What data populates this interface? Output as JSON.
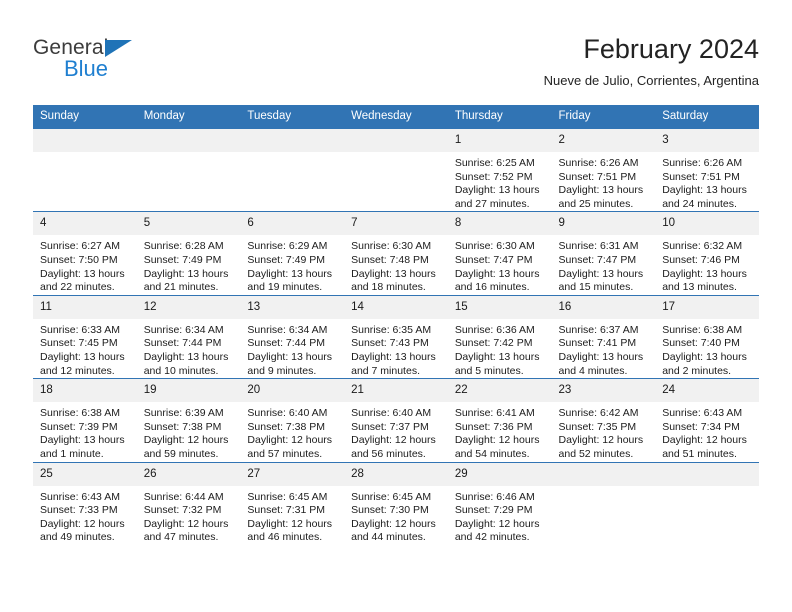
{
  "brand": {
    "name_part1": "General",
    "name_part2": "Blue",
    "accent_color": "#1f7fd0",
    "triangle_color": "#1f73b7"
  },
  "header": {
    "title": "February 2024",
    "subtitle": "Nueve de Julio, Corrientes, Argentina",
    "header_bg_color": "#3174b4",
    "daynum_bg_color": "#f1f1f1"
  },
  "weekday_headers": [
    "Sunday",
    "Monday",
    "Tuesday",
    "Wednesday",
    "Thursday",
    "Friday",
    "Saturday"
  ],
  "weeks": [
    [
      {
        "day": "",
        "sunrise": "",
        "sunset": "",
        "daylight1": "",
        "daylight2": "",
        "empty": true
      },
      {
        "day": "",
        "sunrise": "",
        "sunset": "",
        "daylight1": "",
        "daylight2": "",
        "empty": true
      },
      {
        "day": "",
        "sunrise": "",
        "sunset": "",
        "daylight1": "",
        "daylight2": "",
        "empty": true
      },
      {
        "day": "",
        "sunrise": "",
        "sunset": "",
        "daylight1": "",
        "daylight2": "",
        "empty": true
      },
      {
        "day": "1",
        "sunrise": "Sunrise: 6:25 AM",
        "sunset": "Sunset: 7:52 PM",
        "daylight1": "Daylight: 13 hours",
        "daylight2": "and 27 minutes.",
        "empty": false
      },
      {
        "day": "2",
        "sunrise": "Sunrise: 6:26 AM",
        "sunset": "Sunset: 7:51 PM",
        "daylight1": "Daylight: 13 hours",
        "daylight2": "and 25 minutes.",
        "empty": false
      },
      {
        "day": "3",
        "sunrise": "Sunrise: 6:26 AM",
        "sunset": "Sunset: 7:51 PM",
        "daylight1": "Daylight: 13 hours",
        "daylight2": "and 24 minutes.",
        "empty": false
      }
    ],
    [
      {
        "day": "4",
        "sunrise": "Sunrise: 6:27 AM",
        "sunset": "Sunset: 7:50 PM",
        "daylight1": "Daylight: 13 hours",
        "daylight2": "and 22 minutes.",
        "empty": false
      },
      {
        "day": "5",
        "sunrise": "Sunrise: 6:28 AM",
        "sunset": "Sunset: 7:49 PM",
        "daylight1": "Daylight: 13 hours",
        "daylight2": "and 21 minutes.",
        "empty": false
      },
      {
        "day": "6",
        "sunrise": "Sunrise: 6:29 AM",
        "sunset": "Sunset: 7:49 PM",
        "daylight1": "Daylight: 13 hours",
        "daylight2": "and 19 minutes.",
        "empty": false
      },
      {
        "day": "7",
        "sunrise": "Sunrise: 6:30 AM",
        "sunset": "Sunset: 7:48 PM",
        "daylight1": "Daylight: 13 hours",
        "daylight2": "and 18 minutes.",
        "empty": false
      },
      {
        "day": "8",
        "sunrise": "Sunrise: 6:30 AM",
        "sunset": "Sunset: 7:47 PM",
        "daylight1": "Daylight: 13 hours",
        "daylight2": "and 16 minutes.",
        "empty": false
      },
      {
        "day": "9",
        "sunrise": "Sunrise: 6:31 AM",
        "sunset": "Sunset: 7:47 PM",
        "daylight1": "Daylight: 13 hours",
        "daylight2": "and 15 minutes.",
        "empty": false
      },
      {
        "day": "10",
        "sunrise": "Sunrise: 6:32 AM",
        "sunset": "Sunset: 7:46 PM",
        "daylight1": "Daylight: 13 hours",
        "daylight2": "and 13 minutes.",
        "empty": false
      }
    ],
    [
      {
        "day": "11",
        "sunrise": "Sunrise: 6:33 AM",
        "sunset": "Sunset: 7:45 PM",
        "daylight1": "Daylight: 13 hours",
        "daylight2": "and 12 minutes.",
        "empty": false
      },
      {
        "day": "12",
        "sunrise": "Sunrise: 6:34 AM",
        "sunset": "Sunset: 7:44 PM",
        "daylight1": "Daylight: 13 hours",
        "daylight2": "and 10 minutes.",
        "empty": false
      },
      {
        "day": "13",
        "sunrise": "Sunrise: 6:34 AM",
        "sunset": "Sunset: 7:44 PM",
        "daylight1": "Daylight: 13 hours",
        "daylight2": "and 9 minutes.",
        "empty": false
      },
      {
        "day": "14",
        "sunrise": "Sunrise: 6:35 AM",
        "sunset": "Sunset: 7:43 PM",
        "daylight1": "Daylight: 13 hours",
        "daylight2": "and 7 minutes.",
        "empty": false
      },
      {
        "day": "15",
        "sunrise": "Sunrise: 6:36 AM",
        "sunset": "Sunset: 7:42 PM",
        "daylight1": "Daylight: 13 hours",
        "daylight2": "and 5 minutes.",
        "empty": false
      },
      {
        "day": "16",
        "sunrise": "Sunrise: 6:37 AM",
        "sunset": "Sunset: 7:41 PM",
        "daylight1": "Daylight: 13 hours",
        "daylight2": "and 4 minutes.",
        "empty": false
      },
      {
        "day": "17",
        "sunrise": "Sunrise: 6:38 AM",
        "sunset": "Sunset: 7:40 PM",
        "daylight1": "Daylight: 13 hours",
        "daylight2": "and 2 minutes.",
        "empty": false
      }
    ],
    [
      {
        "day": "18",
        "sunrise": "Sunrise: 6:38 AM",
        "sunset": "Sunset: 7:39 PM",
        "daylight1": "Daylight: 13 hours",
        "daylight2": "and 1 minute.",
        "empty": false
      },
      {
        "day": "19",
        "sunrise": "Sunrise: 6:39 AM",
        "sunset": "Sunset: 7:38 PM",
        "daylight1": "Daylight: 12 hours",
        "daylight2": "and 59 minutes.",
        "empty": false
      },
      {
        "day": "20",
        "sunrise": "Sunrise: 6:40 AM",
        "sunset": "Sunset: 7:38 PM",
        "daylight1": "Daylight: 12 hours",
        "daylight2": "and 57 minutes.",
        "empty": false
      },
      {
        "day": "21",
        "sunrise": "Sunrise: 6:40 AM",
        "sunset": "Sunset: 7:37 PM",
        "daylight1": "Daylight: 12 hours",
        "daylight2": "and 56 minutes.",
        "empty": false
      },
      {
        "day": "22",
        "sunrise": "Sunrise: 6:41 AM",
        "sunset": "Sunset: 7:36 PM",
        "daylight1": "Daylight: 12 hours",
        "daylight2": "and 54 minutes.",
        "empty": false
      },
      {
        "day": "23",
        "sunrise": "Sunrise: 6:42 AM",
        "sunset": "Sunset: 7:35 PM",
        "daylight1": "Daylight: 12 hours",
        "daylight2": "and 52 minutes.",
        "empty": false
      },
      {
        "day": "24",
        "sunrise": "Sunrise: 6:43 AM",
        "sunset": "Sunset: 7:34 PM",
        "daylight1": "Daylight: 12 hours",
        "daylight2": "and 51 minutes.",
        "empty": false
      }
    ],
    [
      {
        "day": "25",
        "sunrise": "Sunrise: 6:43 AM",
        "sunset": "Sunset: 7:33 PM",
        "daylight1": "Daylight: 12 hours",
        "daylight2": "and 49 minutes.",
        "empty": false
      },
      {
        "day": "26",
        "sunrise": "Sunrise: 6:44 AM",
        "sunset": "Sunset: 7:32 PM",
        "daylight1": "Daylight: 12 hours",
        "daylight2": "and 47 minutes.",
        "empty": false
      },
      {
        "day": "27",
        "sunrise": "Sunrise: 6:45 AM",
        "sunset": "Sunset: 7:31 PM",
        "daylight1": "Daylight: 12 hours",
        "daylight2": "and 46 minutes.",
        "empty": false
      },
      {
        "day": "28",
        "sunrise": "Sunrise: 6:45 AM",
        "sunset": "Sunset: 7:30 PM",
        "daylight1": "Daylight: 12 hours",
        "daylight2": "and 44 minutes.",
        "empty": false
      },
      {
        "day": "29",
        "sunrise": "Sunrise: 6:46 AM",
        "sunset": "Sunset: 7:29 PM",
        "daylight1": "Daylight: 12 hours",
        "daylight2": "and 42 minutes.",
        "empty": false
      },
      {
        "day": "",
        "sunrise": "",
        "sunset": "",
        "daylight1": "",
        "daylight2": "",
        "empty": true
      },
      {
        "day": "",
        "sunrise": "",
        "sunset": "",
        "daylight1": "",
        "daylight2": "",
        "empty": true
      }
    ]
  ]
}
